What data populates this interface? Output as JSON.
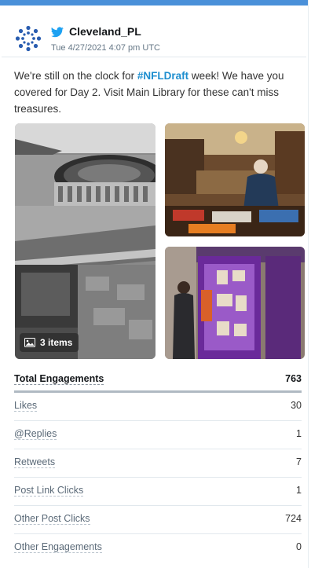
{
  "tweet": {
    "account": "Cleveland_PL",
    "timestamp": "Tue 4/27/2021 4:07 pm UTC",
    "text_before": "We're still on the clock for ",
    "hashtag": "#NFLDraft",
    "text_after": " week! We have you covered for Day 2. Visit Main Library for these can't miss treasures."
  },
  "media": {
    "count_label": "3 items",
    "icon": "images-icon"
  },
  "engagement": {
    "total": {
      "label": "Total Engagements",
      "value": "763"
    },
    "rows": [
      {
        "label": "Likes",
        "value": "30"
      },
      {
        "label": "@Replies",
        "value": "1"
      },
      {
        "label": "Retweets",
        "value": "7"
      },
      {
        "label": "Post Link Clicks",
        "value": "1"
      },
      {
        "label": "Other Post Clicks",
        "value": "724"
      },
      {
        "label": "Other Engagements",
        "value": "0"
      }
    ]
  },
  "colors": {
    "accent": "#4a90d9",
    "hashtag": "#1d8ecf",
    "twitter": "#1da1f2"
  }
}
